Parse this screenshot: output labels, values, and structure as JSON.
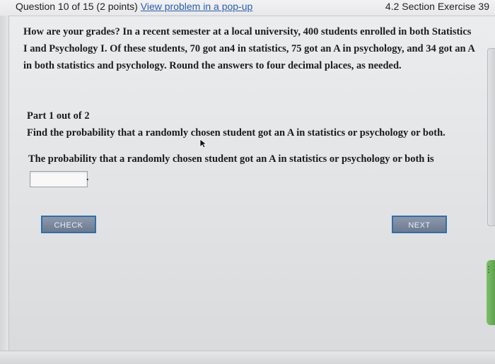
{
  "header": {
    "question_counter": "Question 10 of 15 (2 points)",
    "popup_link": "View problem in a pop-up",
    "section_label": "4.2 Section Exercise 39"
  },
  "problem": {
    "text": "How are your grades? In a recent semester at a local university, 400 students enrolled in both Statistics I and Psychology I. Of these students, 70 got an4 in statistics, 75 got an A in psychology, and 34 got an A in both statistics and psychology. Round the answers to four decimal places, as needed."
  },
  "part": {
    "title": "Part 1 out of 2",
    "question": "Find the probability that a randomly chosen student got an A in statistics or psychology or both."
  },
  "answer": {
    "prompt": "The probability that a randomly chosen student got an A in statistics or psychology or both is",
    "value": "",
    "suffix": "."
  },
  "buttons": {
    "check": "CHECK",
    "next": "NEXT"
  },
  "colors": {
    "link": "#2a5fb0",
    "button_border": "#2f6fa8",
    "side_tab_green": "#6cb05a"
  }
}
